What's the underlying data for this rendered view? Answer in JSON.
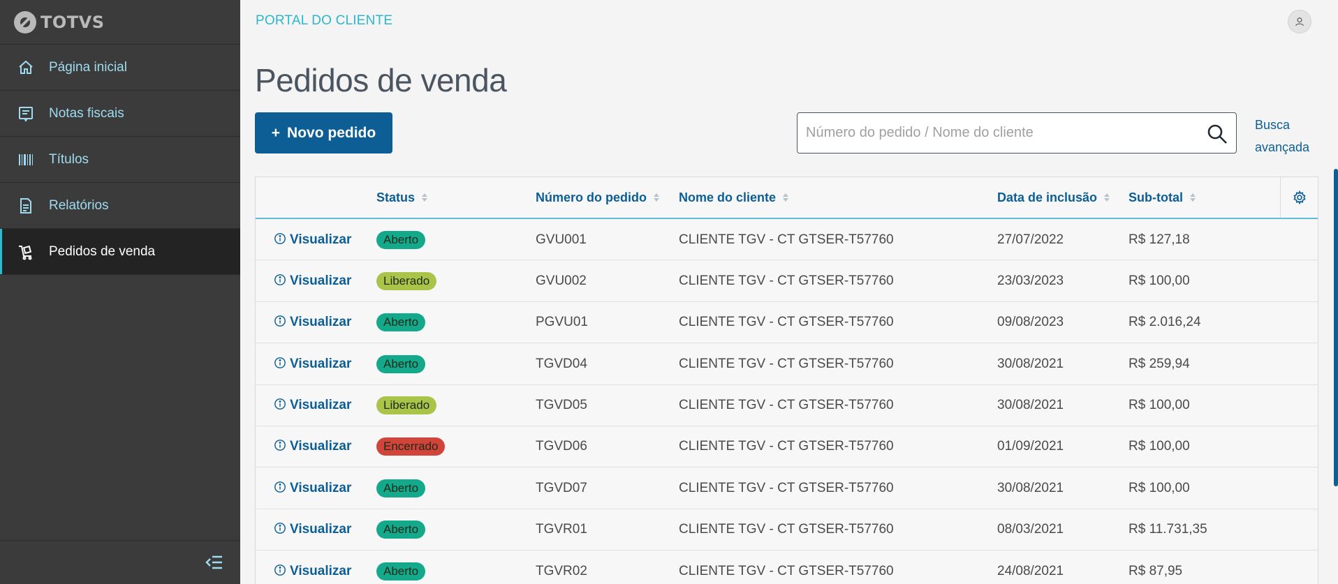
{
  "brand": {
    "name": "TOTVS"
  },
  "sidebar": {
    "items": [
      {
        "label": "Página inicial",
        "icon": "home-icon",
        "active": false
      },
      {
        "label": "Notas fiscais",
        "icon": "invoice-icon",
        "active": false
      },
      {
        "label": "Títulos",
        "icon": "barcode-icon",
        "active": false
      },
      {
        "label": "Relatórios",
        "icon": "report-icon",
        "active": false
      },
      {
        "label": "Pedidos de venda",
        "icon": "cart-icon",
        "active": true
      }
    ],
    "collapse_icon": "collapse-menu-icon"
  },
  "header": {
    "portal_title": "PORTAL DO CLIENTE",
    "avatar_icon": "user-icon"
  },
  "page": {
    "title": "Pedidos de venda",
    "new_button": "Novo pedido",
    "new_button_prefix": "+",
    "search_placeholder": "Número do pedido / Nome do cliente",
    "advanced_search_line1": "Busca",
    "advanced_search_line2": "avançada"
  },
  "table": {
    "columns": [
      "Status",
      "Número do pedido",
      "Nome do cliente",
      "Data de inclusão",
      "Sub-total"
    ],
    "action_label": "Visualizar",
    "rows": [
      {
        "status": "Aberto",
        "number": "GVU001",
        "client": "CLIENTE TGV - CT GTSER-T57760",
        "date": "27/07/2022",
        "subtotal": "R$ 127,18"
      },
      {
        "status": "Liberado",
        "number": "GVU002",
        "client": "CLIENTE TGV - CT GTSER-T57760",
        "date": "23/03/2023",
        "subtotal": "R$ 100,00"
      },
      {
        "status": "Aberto",
        "number": "PGVU01",
        "client": "CLIENTE TGV - CT GTSER-T57760",
        "date": "09/08/2023",
        "subtotal": "R$ 2.016,24"
      },
      {
        "status": "Aberto",
        "number": "TGVD04",
        "client": "CLIENTE TGV - CT GTSER-T57760",
        "date": "30/08/2021",
        "subtotal": "R$ 259,94"
      },
      {
        "status": "Liberado",
        "number": "TGVD05",
        "client": "CLIENTE TGV - CT GTSER-T57760",
        "date": "30/08/2021",
        "subtotal": "R$ 100,00"
      },
      {
        "status": "Encerrado",
        "number": "TGVD06",
        "client": "CLIENTE TGV - CT GTSER-T57760",
        "date": "01/09/2021",
        "subtotal": "R$ 100,00"
      },
      {
        "status": "Aberto",
        "number": "TGVD07",
        "client": "CLIENTE TGV - CT GTSER-T57760",
        "date": "30/08/2021",
        "subtotal": "R$ 100,00"
      },
      {
        "status": "Aberto",
        "number": "TGVR01",
        "client": "CLIENTE TGV - CT GTSER-T57760",
        "date": "08/03/2021",
        "subtotal": "R$ 11.731,35"
      },
      {
        "status": "Aberto",
        "number": "TGVR02",
        "client": "CLIENTE TGV - CT GTSER-T57760",
        "date": "24/08/2021",
        "subtotal": "R$ 87,95"
      }
    ]
  },
  "colors": {
    "Aberto": "#13a98a",
    "Liberado": "#a9c448",
    "Encerrado": "#d0443a",
    "primary": "#0c5e95",
    "sidebar_bg": "#3b3b3b",
    "accent": "#2bb6cc"
  }
}
